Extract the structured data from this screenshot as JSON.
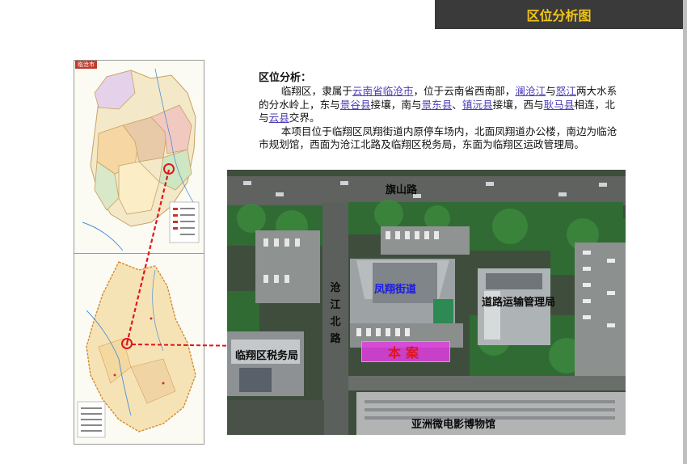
{
  "header": {
    "title": "区位分析图",
    "bar_color": "#3a3a3a",
    "title_color": "#f0c419"
  },
  "maps": {
    "city_map": {
      "tag": "临沧市"
    },
    "county_map": {}
  },
  "analysis": {
    "title": "区位分析：",
    "para1": {
      "t1": "临翔区，隶属于",
      "l1": "云南省临沧市",
      "t2": "，位于云南省西南部，",
      "l2": "澜沧江",
      "t3": "与",
      "l3": "怒江",
      "t4": "两大水系的分水岭上，东与",
      "l4": "景谷县",
      "t5": "接壤，南与",
      "l5": "景东县",
      "t6": "、",
      "l6": "镇沅县",
      "t7": "接壤，西与",
      "l7": "耿马县",
      "t8": "相连，北与",
      "l8": "云县",
      "t9": "交界。"
    },
    "para2": "本项目位于临翔区凤翔街道内原停车场内，北面凤翔道办公楼，南边为临沧市规划馆，西面为沧江北路及临翔区税务局，东面为临翔区运政管理局。",
    "link_color": "#4b3db5"
  },
  "photo": {
    "labels": {
      "qishan_road": "旗山路",
      "fengxiang": "凤翔街道",
      "road_transport": "道路运输管理局",
      "tax_bureau": "临翔区税务局",
      "museum": "亚洲微电影博物馆",
      "cangjiang_road": [
        "沧",
        "江",
        "北",
        "路"
      ],
      "site": "本案"
    },
    "site_color": "#e63ce6"
  }
}
